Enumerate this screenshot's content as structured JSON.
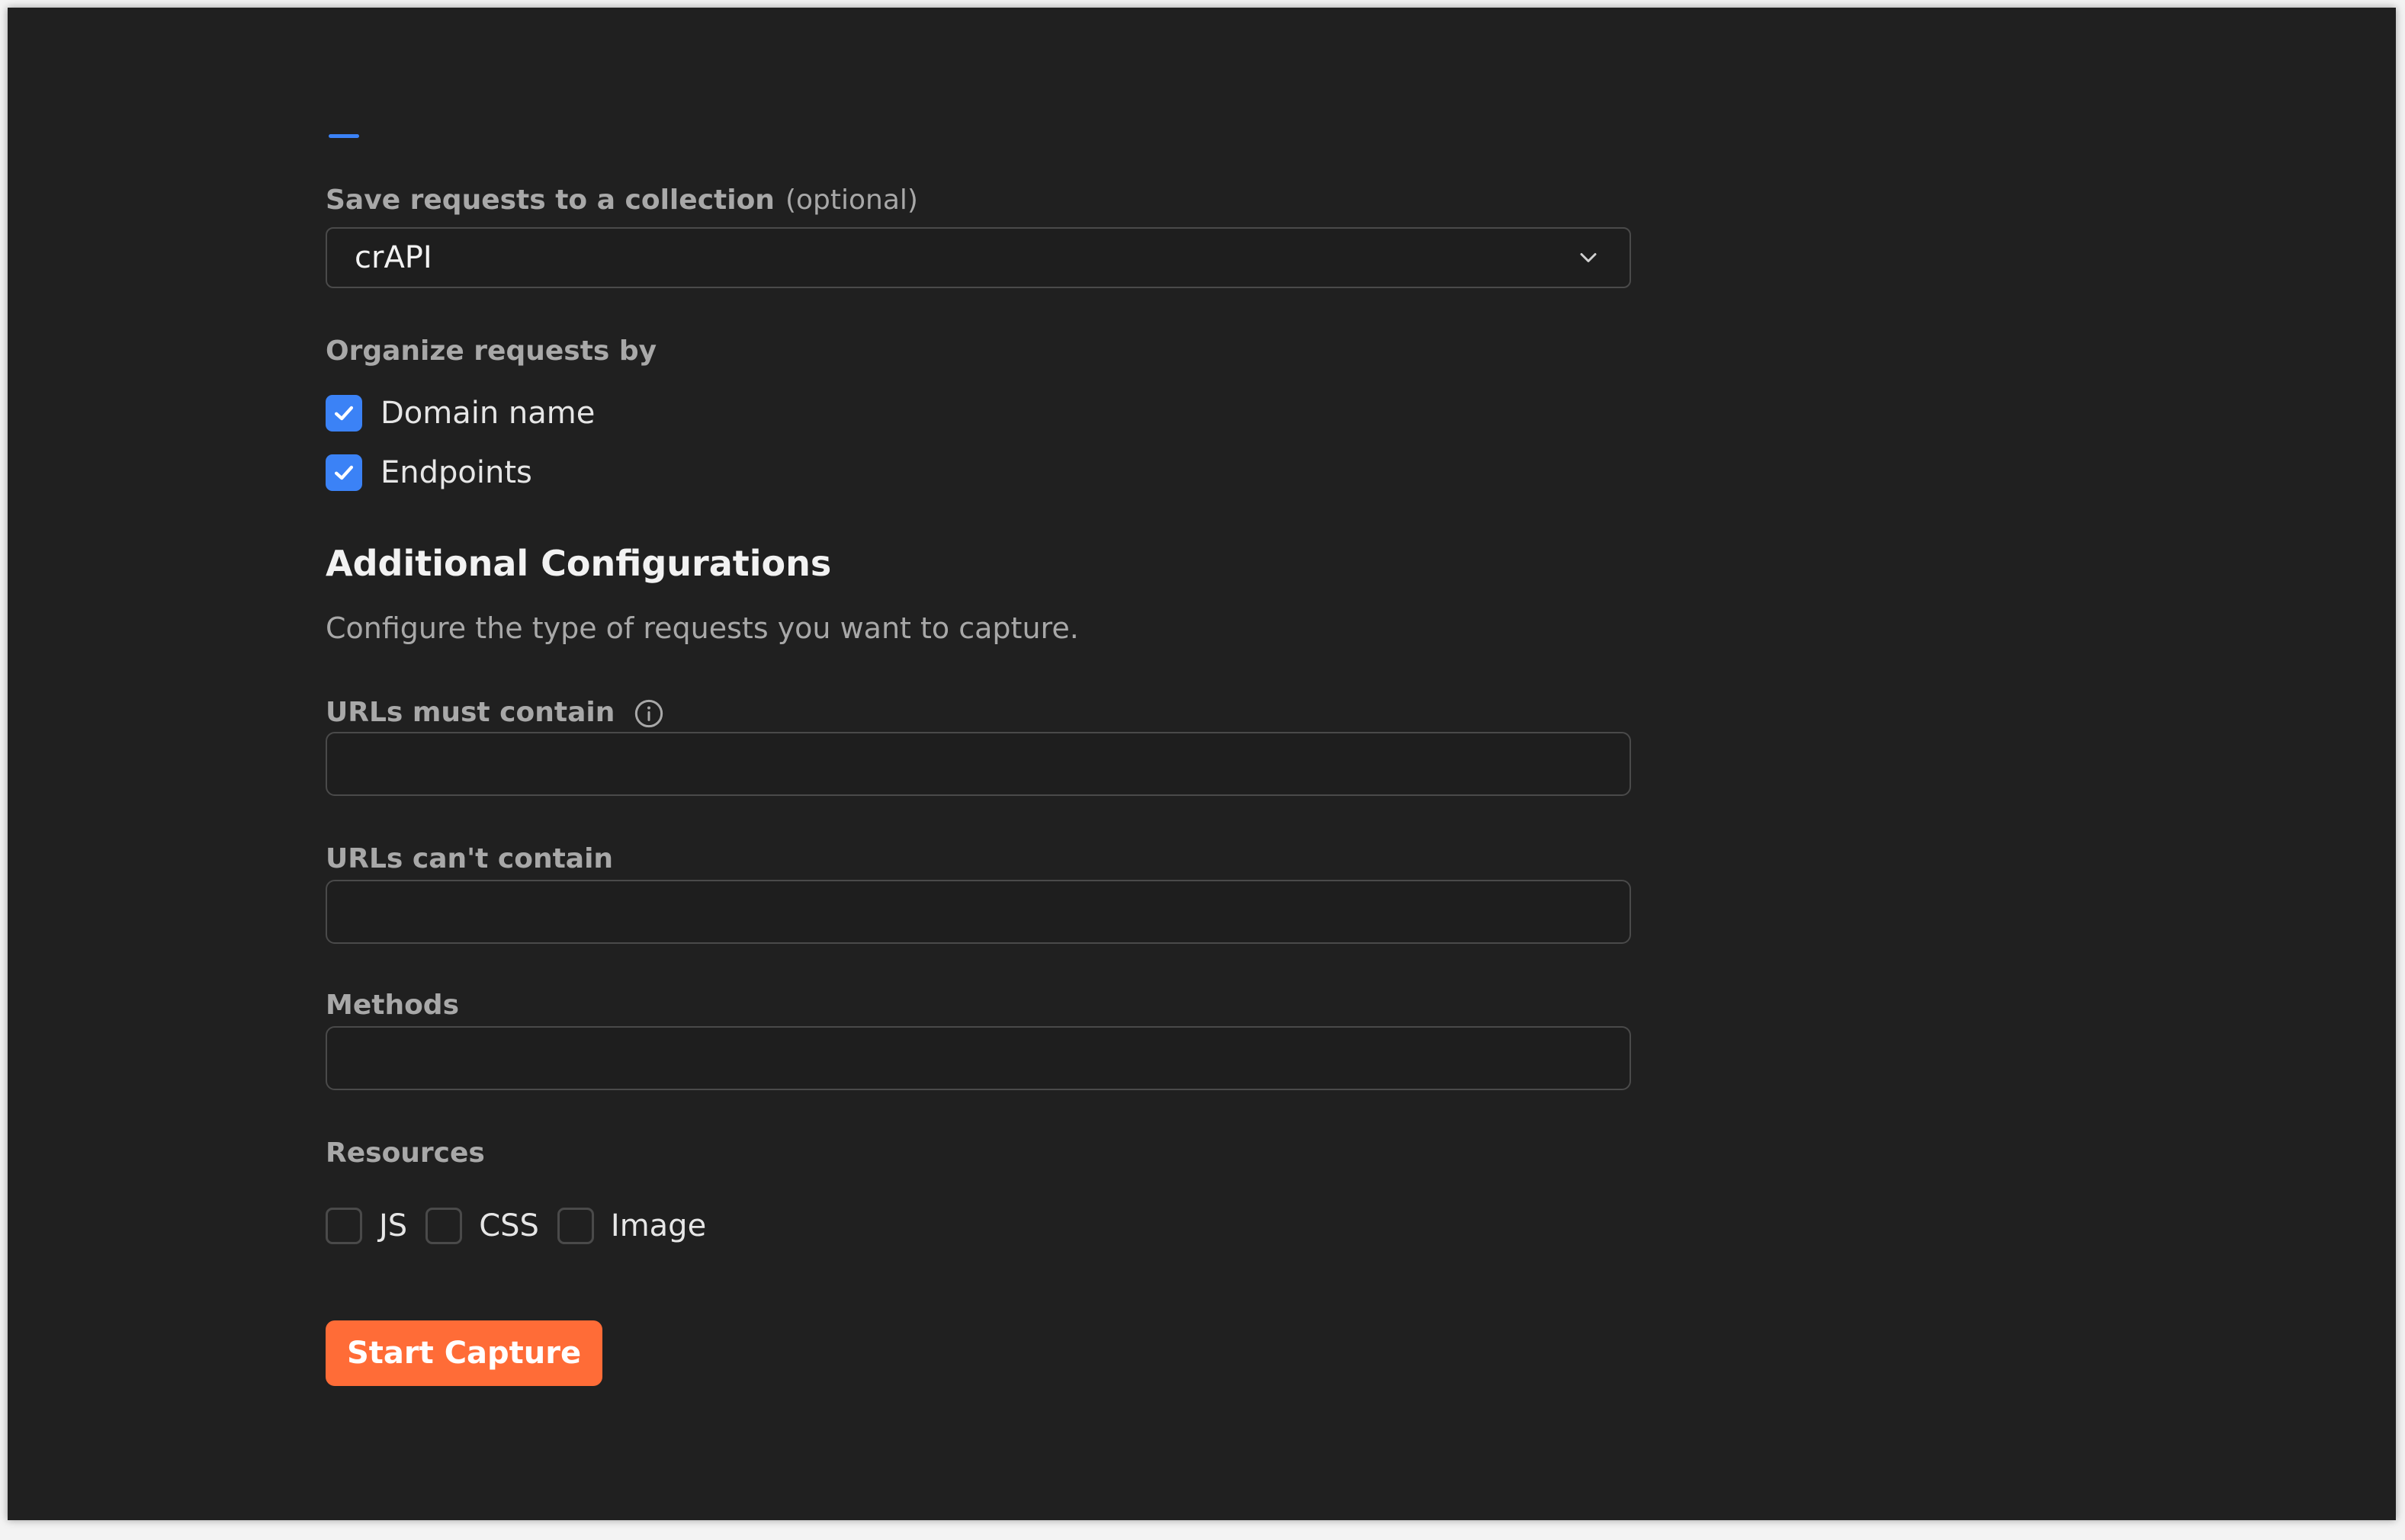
{
  "collection": {
    "label": "Save requests to a collection",
    "optional_text": "(optional)",
    "selected": "crAPI"
  },
  "organize": {
    "label": "Organize requests by",
    "options": [
      {
        "label": "Domain name",
        "checked": true
      },
      {
        "label": "Endpoints",
        "checked": true
      }
    ]
  },
  "additional": {
    "title": "Additional Configurations",
    "description": "Configure the type of requests you want to capture."
  },
  "urls_must_contain": {
    "label": "URLs must contain",
    "value": ""
  },
  "urls_cant_contain": {
    "label": "URLs can't contain",
    "value": ""
  },
  "methods": {
    "label": "Methods",
    "value": ""
  },
  "resources": {
    "label": "Resources",
    "options": [
      {
        "label": "JS",
        "checked": false
      },
      {
        "label": "CSS",
        "checked": false
      },
      {
        "label": "Image",
        "checked": false
      }
    ]
  },
  "actions": {
    "start_label": "Start Capture"
  },
  "colors": {
    "accent": "#ff6c37",
    "checkbox": "#3b82f6",
    "background": "#202020"
  },
  "icons": {
    "dropdown": "chevron-down-icon",
    "checked": "checkmark-icon",
    "info": "info-icon"
  }
}
